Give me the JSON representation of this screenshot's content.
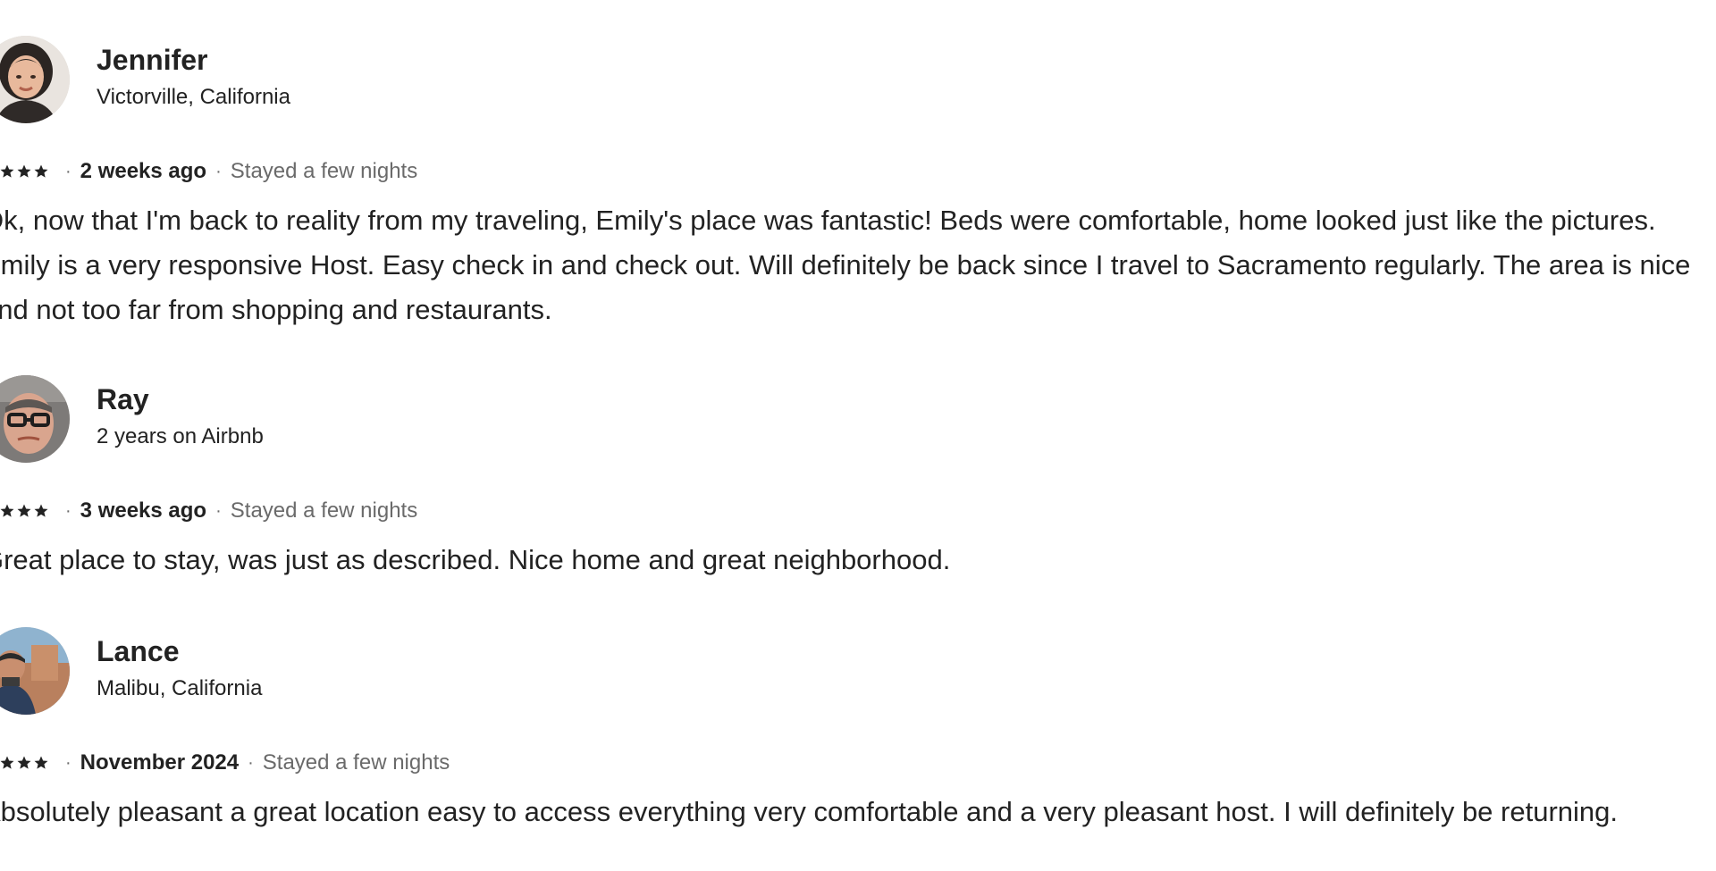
{
  "reviews": [
    {
      "name": "Jennifer",
      "subtitle": "Victorville, California",
      "rating": 4,
      "date": "2 weeks ago",
      "stay": "Stayed a few nights",
      "text": "Ok, now that I'm back to reality from my traveling, Emily's place was fantastic! Beds were comfortable, home looked just like the pictures. Emily is a very responsive Host. Easy check in and check out. Will definitely be back since I travel to Sacramento regularly. The area is nice and not too far from shopping and restaurants."
    },
    {
      "name": "Ray",
      "subtitle": "2 years on Airbnb",
      "rating": 4,
      "date": "3 weeks ago",
      "stay": "Stayed a few nights",
      "text": "Great place to stay, was just as described. Nice home and great neighborhood."
    },
    {
      "name": "Lance",
      "subtitle": "Malibu, California",
      "rating": 4,
      "date": "November 2024",
      "stay": "Stayed a few nights",
      "text": "Absolutely pleasant a great location easy to access everything very comfortable and a very pleasant host. I will definitely be returning."
    }
  ],
  "separator": "·",
  "icons": {
    "star": "star-icon",
    "avatar": "avatar"
  },
  "colors": {
    "text": "#222222",
    "muted": "#6a6a6a"
  }
}
